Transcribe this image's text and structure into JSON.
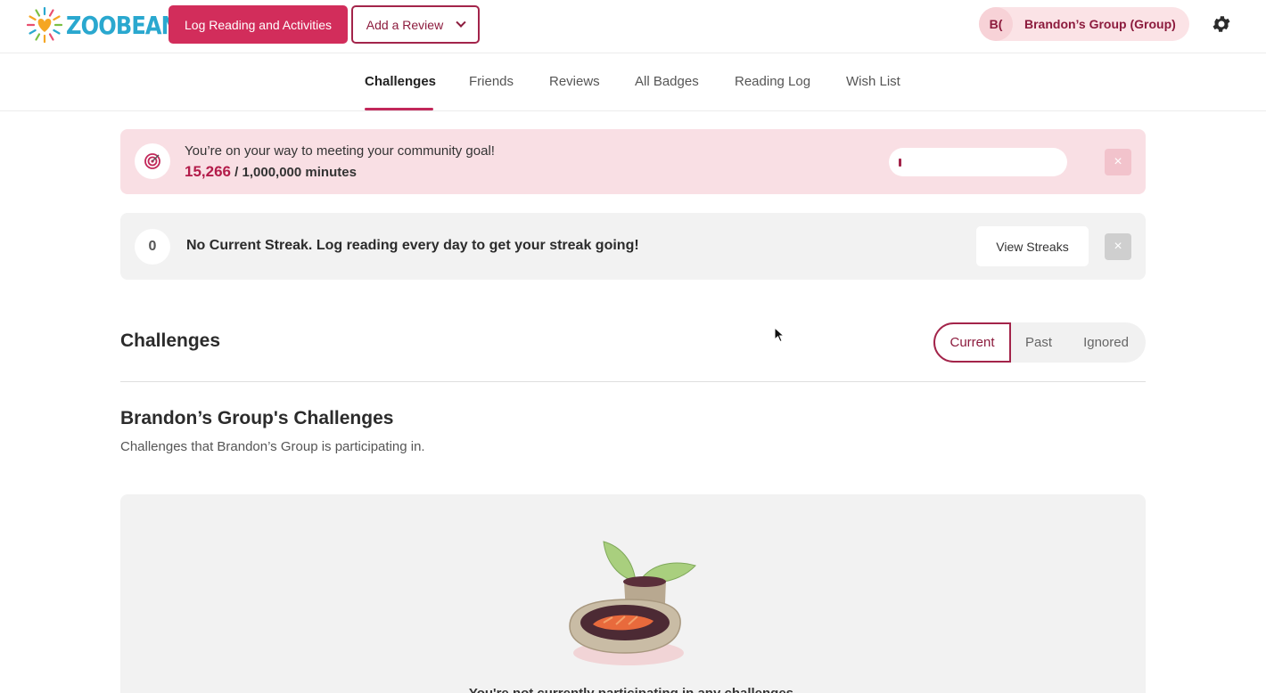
{
  "header": {
    "logo_text": "ZOOBEAN",
    "log_button": "Log Reading and Activities",
    "review_button": "Add a Review",
    "group": {
      "initials": "B(",
      "name": "Brandon’s Group (Group)"
    }
  },
  "tabs": [
    {
      "label": "Challenges",
      "active": true
    },
    {
      "label": "Friends"
    },
    {
      "label": "Reviews"
    },
    {
      "label": "All Badges"
    },
    {
      "label": "Reading Log"
    },
    {
      "label": "Wish List"
    }
  ],
  "goal_banner": {
    "message": "You’re on your way to meeting your community goal!",
    "current": "15,266",
    "total": "/ 1,000,000 minutes",
    "progress_fraction": 0.0153,
    "close": "×"
  },
  "streak_banner": {
    "count": "0",
    "message": "No Current Streak. Log reading every day to get your streak going!",
    "view_button": "View Streaks",
    "close": "×"
  },
  "challenges": {
    "title": "Challenges",
    "filters": [
      "Current",
      "Past",
      "Ignored"
    ],
    "selected_filter": "Current",
    "group_title": "Brandon’s Group's Challenges",
    "group_subtitle": "Challenges that Brandon’s Group is participating in.",
    "empty_message": "You're not currently participating in any challenges."
  },
  "colors": {
    "brand": "#d22d5b",
    "accent_dark": "#8c1b3d",
    "goal_bg": "#f9dfe4",
    "logo": "#2aa8cf"
  }
}
